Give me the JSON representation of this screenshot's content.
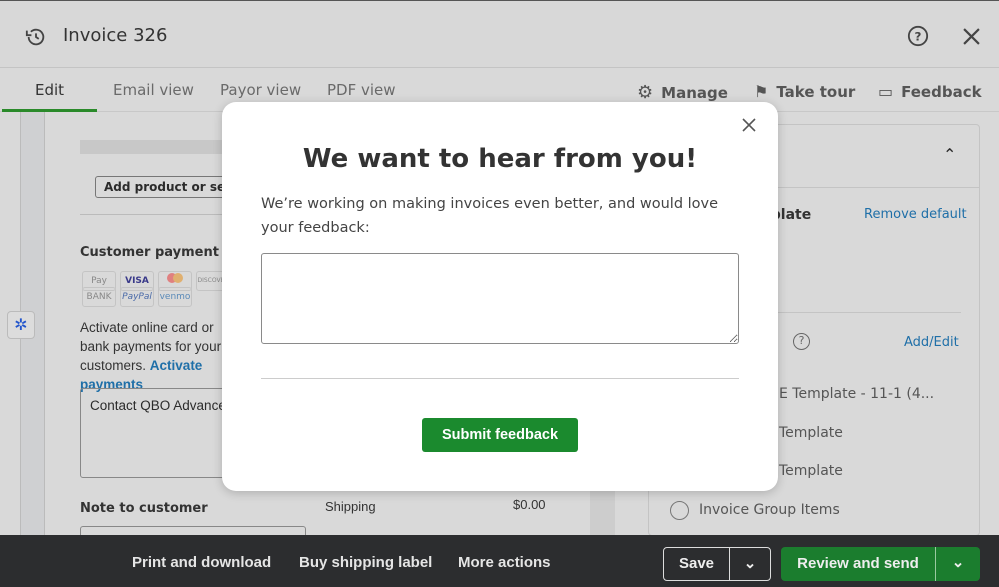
{
  "header": {
    "title": "Invoice 326",
    "history_icon": "history-icon",
    "help_icon": "help-icon",
    "close_icon": "close-icon"
  },
  "tabs": [
    {
      "label": "Edit",
      "active": true
    },
    {
      "label": "Email view"
    },
    {
      "label": "Payor view"
    },
    {
      "label": "PDF view"
    }
  ],
  "tools": {
    "manage": "Manage",
    "take_tour": "Take tour",
    "feedback": "Feedback"
  },
  "form": {
    "add_product": "Add product or service",
    "payment_options": "Customer payment options",
    "cards": [
      "Pay",
      "VISA",
      "",
      "DISCOVER",
      "BANK",
      "PayPal",
      "venmo"
    ],
    "activate_text": "Activate online card or bank payments for your customers.",
    "activate_link": "Activate payments",
    "message_value": "Contact QBO Advanced",
    "note_label": "Note to customer",
    "shipping_label": "Shipping",
    "shipping_value": "$0.00"
  },
  "right": {
    "template_label": "Template",
    "remove_default": "Remove default",
    "add_edit": "Add/Edit",
    "templates": [
      "E Template - 11-1 (4...",
      "Template",
      "Template",
      "Invoice Group Items"
    ]
  },
  "bottom": {
    "print": "Print and download",
    "shipping": "Buy shipping label",
    "more": "More actions",
    "save": "Save",
    "review": "Review and send"
  },
  "dialog": {
    "title": "We want to hear from you!",
    "body": "We’re working on making invoices even better, and would love your feedback:",
    "textarea_value": "",
    "submit": "Submit feedback"
  },
  "colors": {
    "accent_green": "#1b8a2e",
    "link_blue": "#1f6fa8",
    "bottom_bar": "#2c2d2f"
  }
}
